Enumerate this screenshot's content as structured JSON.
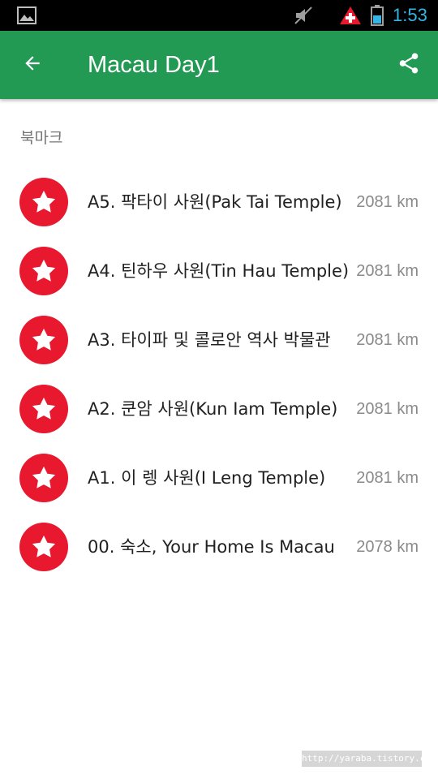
{
  "status_bar": {
    "time": "1:53",
    "icons": [
      "gallery-icon",
      "mute-icon",
      "alert-icon",
      "battery-icon"
    ],
    "time_color": "#33b5e5"
  },
  "app_bar": {
    "title": "Macau Day1",
    "background": "#229a54",
    "back_icon": "arrow-back-icon",
    "share_icon": "share-icon"
  },
  "section": {
    "header": "북마크"
  },
  "bookmarks": [
    {
      "title": "A5. 팍타이 사원(Pak Tai Temple)",
      "distance": "2081 km"
    },
    {
      "title": "A4. 틴하우 사원(Tin Hau Temple)",
      "distance": "2081 km"
    },
    {
      "title": "A3. 타이파 및 콜로안 역사 박물관",
      "distance": "2081 km"
    },
    {
      "title": "A2. 쿤암 사원(Kun Iam Temple)",
      "distance": "2081 km"
    },
    {
      "title": "A1. 이 렝 사원(I Leng Temple)",
      "distance": "2081 km"
    },
    {
      "title": "00. 숙소, Your Home Is Macau",
      "distance": "2078 km"
    }
  ],
  "bookmark_icon": "star-icon",
  "bookmark_color": "#e8182e",
  "watermark": "http://yaraba.tistory.com"
}
